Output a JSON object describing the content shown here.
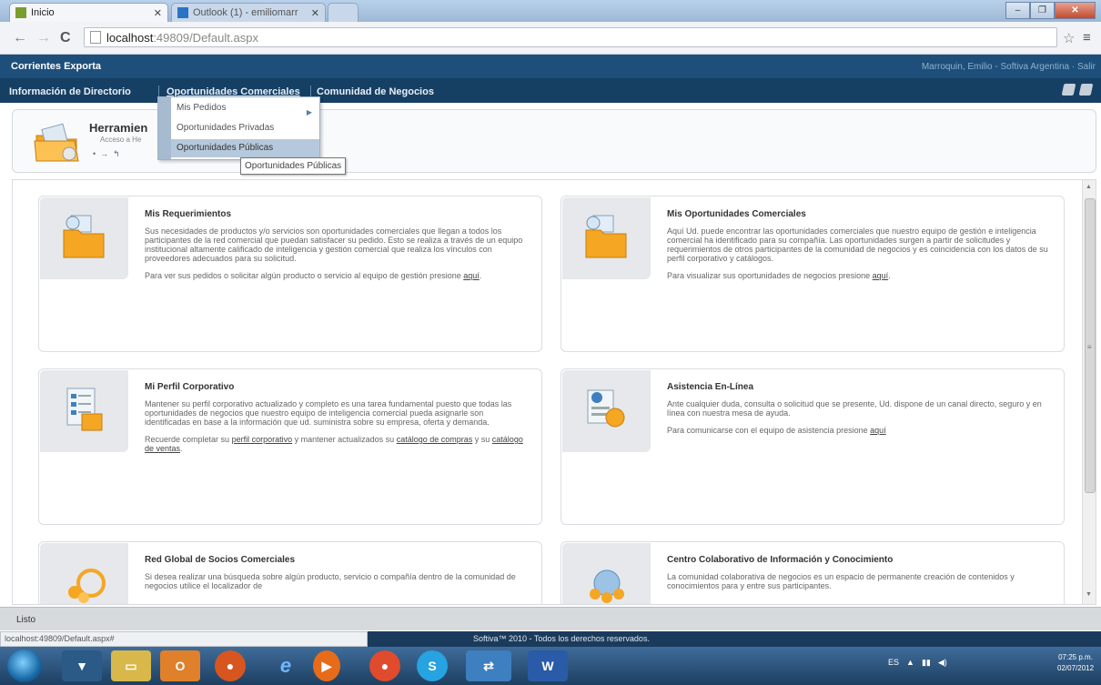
{
  "browser": {
    "tabs": [
      {
        "label": "Inicio",
        "active": true
      },
      {
        "label": "Outlook (1) - emiliomarr",
        "active": false
      }
    ],
    "url_host": "localhost",
    "url_path": ":49809/Default.aspx"
  },
  "app": {
    "title": "Corrientes Exporta",
    "user": "Marroquin, Emilio - Softiva Argentina · Salir",
    "nav": [
      "Información de Directorio",
      "Oportunidades Comerciales",
      "Comunidad de Negocios"
    ]
  },
  "tools": {
    "title": "Herramien",
    "subtitle": "Acceso a He"
  },
  "dropdown": {
    "items": [
      "Mis Pedidos",
      "Oportunidades Privadas",
      "Oportunidades Públicas"
    ],
    "tooltip": "Oportunidades Públicas"
  },
  "cards": [
    {
      "title": "Mis Requerimientos",
      "text1": "Sus necesidades de productos y/o servicios son oportunidades comerciales que llegan a todos los participantes de la red comercial que puedan satisfacer su pedido. Esto se realiza a través de un equipo institucional altamente calificado de inteligencia y gestión comercial que realiza los vínculos con proveedores adecuados para su solicitud.",
      "text2": "Para ver sus pedidos o solicitar algún producto o servicio al equipo de gestión presione",
      "link": "aquí"
    },
    {
      "title": "Mis Oportunidades Comerciales",
      "text1": "Aquí Ud. puede encontrar las oportunidades comerciales que nuestro equipo de gestión e inteligencia comercial ha identificado para su compañía. Las oportunidades surgen a partir de solicitudes y requerimientos de otros participantes de la comunidad de negocios y es coincidencia con los datos de su perfil corporativo y catálogos.",
      "text2": "Para visualizar sus oportunidades de negocios presione",
      "link": "aquí"
    },
    {
      "title": "Mi Perfil Corporativo",
      "text1": "Mantener su perfil corporativo actualizado y completo es una tarea fundamental puesto que todas las oportunidades de negocios que nuestro equipo de inteligencia comercial pueda asignarle son identificadas en base a la información que ud. suministra sobre su empresa, oferta y demanda.",
      "text2a": "Recuerde completar su",
      "link_a": "perfil corporativo",
      "text2b": "y mantener actualizados su",
      "link_b": "catálogo de compras",
      "text2c": "y su",
      "link_c": "catálogo de ventas"
    },
    {
      "title": "Asistencia En-Línea",
      "text1": "Ante cualquier duda, consulta o solicitud que se presente, Ud. dispone de un canal directo, seguro y en línea con nuestra mesa de ayuda.",
      "text2": "Para comunicarse con el equipo de asistencia presione",
      "link": "aquí"
    },
    {
      "title": "Red Global de Socios Comerciales",
      "text1": "Si desea realizar una búsqueda sobre algún producto, servicio o compañía dentro de la comunidad de negocios utilice el localizador de"
    },
    {
      "title": "Centro Colaborativo de Información y Conocimiento",
      "text1": "La comunidad colaborativa de negocios es un espacio de permanente creación de contenidos y conocimientos para y entre sus participantes."
    }
  ],
  "status": {
    "text": "Listo",
    "hover_url": "localhost:49809/Default.aspx#",
    "footer": "Softiva™ 2010 - Todos los derechos reservados."
  },
  "taskbar": {
    "lang": "ES",
    "time": "07:25 p.m.",
    "date": "02/07/2012"
  },
  "colors": {
    "header": "#1d4f7a",
    "nav": "#163f64",
    "accent_icon": "#f5a623"
  }
}
